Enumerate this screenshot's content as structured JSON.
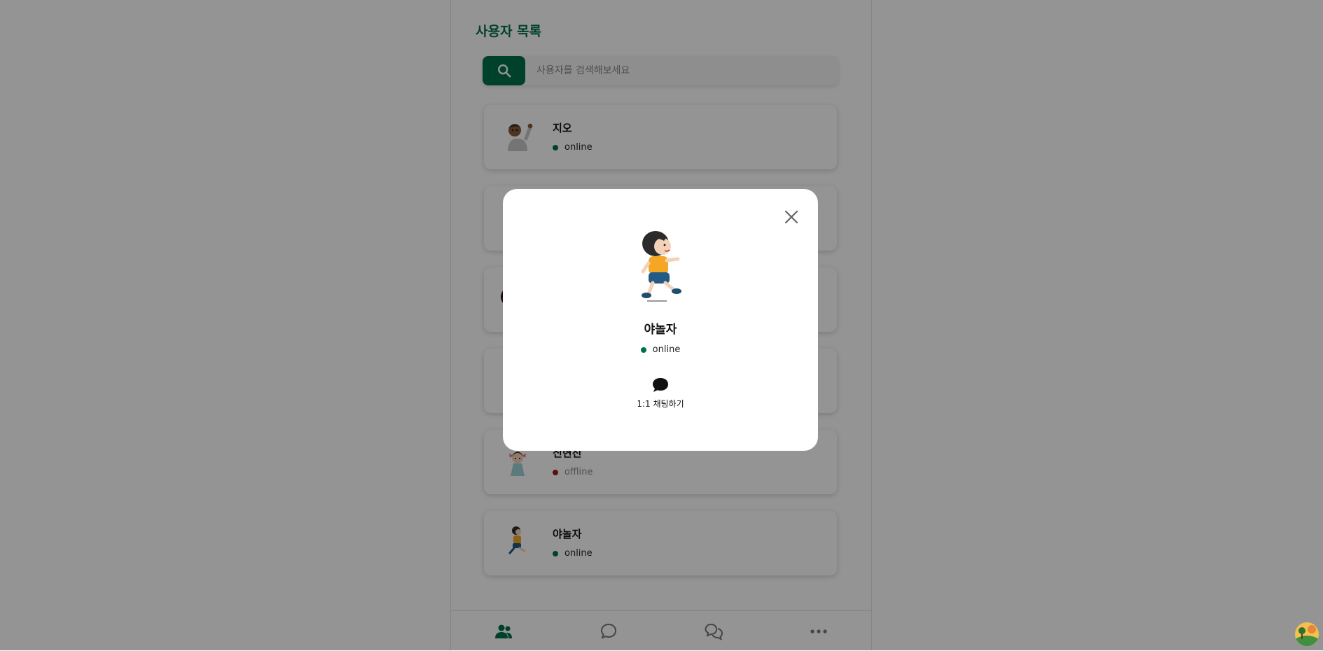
{
  "page": {
    "title": "사용자 목록"
  },
  "search": {
    "placeholder": "사용자를 검색해보세요",
    "icon": "search-icon"
  },
  "users": [
    {
      "name": "지오",
      "status": "online",
      "avatar": "waving-person-avatar"
    },
    {
      "name": "",
      "status": "",
      "avatar": ""
    },
    {
      "name": "",
      "status": "",
      "avatar": ""
    },
    {
      "name": "",
      "status": "",
      "avatar": ""
    },
    {
      "name": "신현진",
      "status": "offline",
      "avatar": "girl-avatar"
    },
    {
      "name": "야놀자",
      "status": "online",
      "avatar": "running-boy-avatar"
    }
  ],
  "tabs": [
    {
      "icon": "users-icon",
      "active": true
    },
    {
      "icon": "chat-bubble-icon",
      "active": false
    },
    {
      "icon": "chats-icon",
      "active": false
    },
    {
      "icon": "more-icon",
      "active": false
    }
  ],
  "modal": {
    "name": "야놀자",
    "status": "online",
    "chat_label": "1:1 채팅하기",
    "avatar": "running-boy-avatar"
  },
  "colors": {
    "brand": "#00704a",
    "online": "#00704a",
    "offline": "#a31515",
    "overlay": "rgba(0,0,0,0.42)"
  }
}
